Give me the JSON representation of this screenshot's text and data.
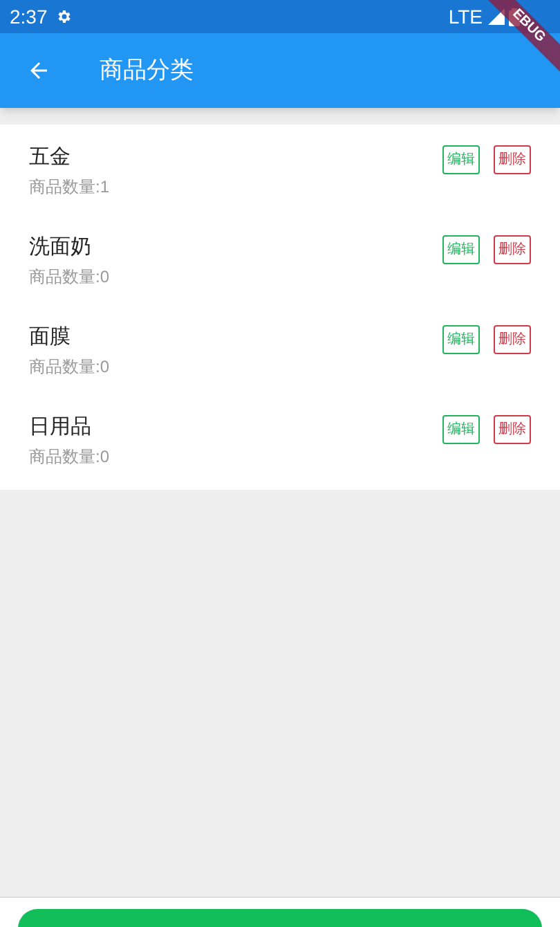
{
  "status_bar": {
    "time": "2:37",
    "network": "LTE"
  },
  "debug_banner": "EBUG",
  "app_bar": {
    "title": "商品分类"
  },
  "categories": [
    {
      "name": "五金",
      "count": "商品数量:1",
      "edit": "编辑",
      "delete": "删除"
    },
    {
      "name": "洗面奶",
      "count": "商品数量:0",
      "edit": "编辑",
      "delete": "删除"
    },
    {
      "name": "面膜",
      "count": "商品数量:0",
      "edit": "编辑",
      "delete": "删除"
    },
    {
      "name": "日用品",
      "count": "商品数量:0",
      "edit": "编辑",
      "delete": "删除"
    }
  ]
}
